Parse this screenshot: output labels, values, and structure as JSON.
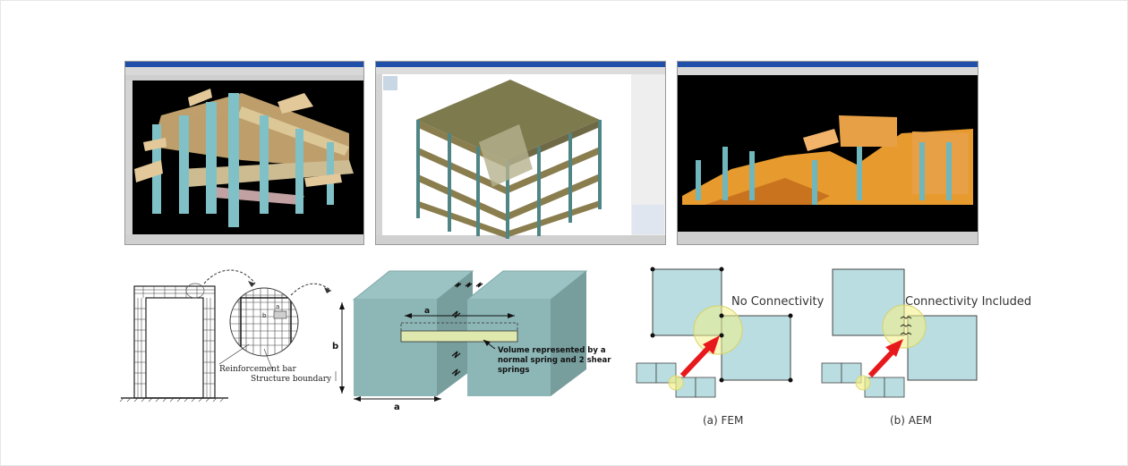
{
  "frame_diagram": {
    "reinforcement_label": "Reinforcement bar",
    "boundary_label": "Structure boundary",
    "a_label": "a",
    "b_label": "b"
  },
  "element_diagram": {
    "a_top": "a",
    "a_bottom": "a",
    "b_label": "b",
    "volume_line1": "Volume represented by a",
    "volume_line2": "normal spring and 2 shear",
    "volume_line3": "springs"
  },
  "fem": {
    "connectivity_label": "No Connectivity",
    "caption": "(a) FEM"
  },
  "aem": {
    "connectivity_label": "Connectivity Included",
    "caption": "(b) AEM"
  },
  "colors": {
    "box_fill": "#b9dde0",
    "highlight": "#f3f08a",
    "arrow": "#e8191c",
    "block_side": "#7ea2a3"
  }
}
